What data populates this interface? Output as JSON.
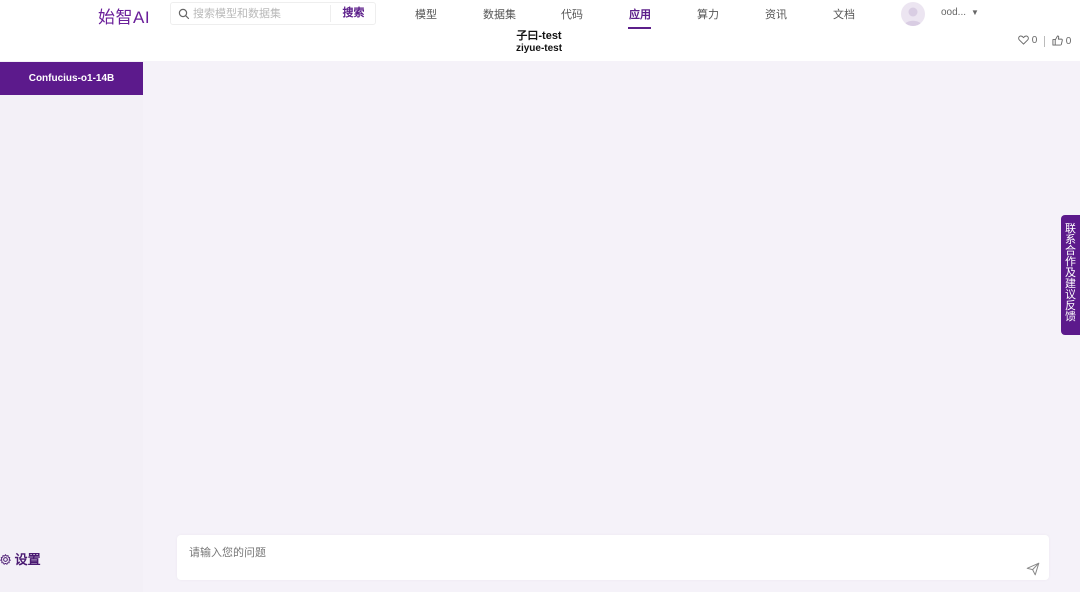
{
  "brand": {
    "logo_text": "始智AI"
  },
  "search": {
    "placeholder": "搜索模型和数据集",
    "button_label": "搜索"
  },
  "nav": {
    "items": [
      {
        "label": "模型"
      },
      {
        "label": "数据集"
      },
      {
        "label": "代码"
      },
      {
        "label": "应用",
        "active": true
      },
      {
        "label": "算力"
      },
      {
        "label": "资讯"
      },
      {
        "label": "文档"
      }
    ]
  },
  "user": {
    "name": "ood..."
  },
  "app": {
    "title_cn": "子曰-test",
    "title_en": "ziyue-test"
  },
  "stats": {
    "likes": "0",
    "thumbs": "0"
  },
  "sidebar": {
    "items": [
      {
        "label": "Confucius-o1-14B",
        "active": true
      }
    ],
    "settings_label": "设置"
  },
  "chat": {
    "input_placeholder": "请输入您的问题"
  },
  "feedback": {
    "label": "联系合作及建议反馈"
  },
  "colors": {
    "accent": "#5c1a8c",
    "main_bg": "#f5f2f9",
    "sidebar_bg": "#f3f0f7"
  }
}
